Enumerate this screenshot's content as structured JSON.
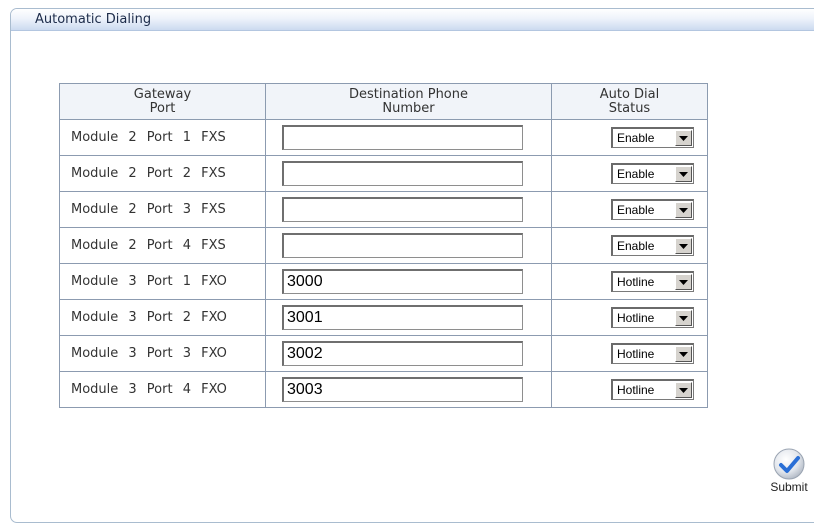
{
  "panel": {
    "title": "Automatic Dialing"
  },
  "table": {
    "headers": [
      "Gateway\nPort",
      "Destination Phone\nNumber",
      "Auto Dial\nStatus"
    ],
    "header_lines": [
      [
        "Gateway",
        "Port"
      ],
      [
        "Destination Phone",
        "Number"
      ],
      [
        "Auto Dial",
        "Status"
      ]
    ],
    "rows": [
      {
        "port": "Module 2 Port 1 FXS",
        "destination": "",
        "status": "Enable"
      },
      {
        "port": "Module 2 Port 2 FXS",
        "destination": "",
        "status": "Enable"
      },
      {
        "port": "Module 2 Port 3 FXS",
        "destination": "",
        "status": "Enable"
      },
      {
        "port": "Module 2 Port 4 FXS",
        "destination": "",
        "status": "Enable"
      },
      {
        "port": "Module 3 Port 1 FXO",
        "destination": "3000",
        "status": "Hotline"
      },
      {
        "port": "Module 3 Port 2 FXO",
        "destination": "3001",
        "status": "Hotline"
      },
      {
        "port": "Module 3 Port 3 FXO",
        "destination": "3002",
        "status": "Hotline"
      },
      {
        "port": "Module 3 Port 4 FXO",
        "destination": "3003",
        "status": "Hotline"
      }
    ]
  },
  "submit": {
    "label": "Submit",
    "icon": "checkmark-icon"
  },
  "colors": {
    "header_bg": "#cbdaf0",
    "accent": "#2a6fd6",
    "border": "#8c9bb0"
  }
}
